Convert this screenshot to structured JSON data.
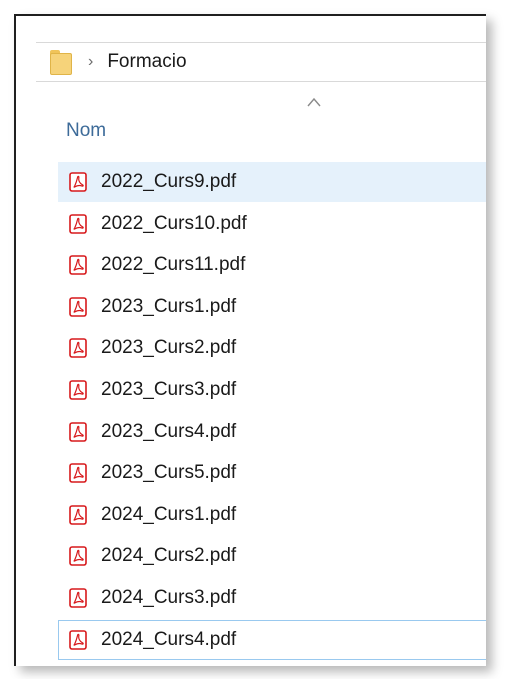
{
  "breadcrumb": {
    "folder_icon": "folder-icon",
    "separator": "›",
    "label": "Formacio"
  },
  "column_header": {
    "label": "Nom",
    "sort_icon": "sort-ascending-icon"
  },
  "files": [
    {
      "name": "2022_Curs9.pdf",
      "icon": "pdf-icon",
      "state": "hover"
    },
    {
      "name": "2022_Curs10.pdf",
      "icon": "pdf-icon"
    },
    {
      "name": "2022_Curs11.pdf",
      "icon": "pdf-icon"
    },
    {
      "name": "2023_Curs1.pdf",
      "icon": "pdf-icon"
    },
    {
      "name": "2023_Curs2.pdf",
      "icon": "pdf-icon"
    },
    {
      "name": "2023_Curs3.pdf",
      "icon": "pdf-icon"
    },
    {
      "name": "2023_Curs4.pdf",
      "icon": "pdf-icon"
    },
    {
      "name": "2023_Curs5.pdf",
      "icon": "pdf-icon"
    },
    {
      "name": "2024_Curs1.pdf",
      "icon": "pdf-icon"
    },
    {
      "name": "2024_Curs2.pdf",
      "icon": "pdf-icon"
    },
    {
      "name": "2024_Curs3.pdf",
      "icon": "pdf-icon"
    },
    {
      "name": "2024_Curs4.pdf",
      "icon": "pdf-icon",
      "state": "focused"
    }
  ],
  "colors": {
    "hover_background": "#e5f1fb",
    "focus_border": "#99c9ef",
    "header_text": "#3d6b99",
    "pdf_red": "#d7191c"
  }
}
